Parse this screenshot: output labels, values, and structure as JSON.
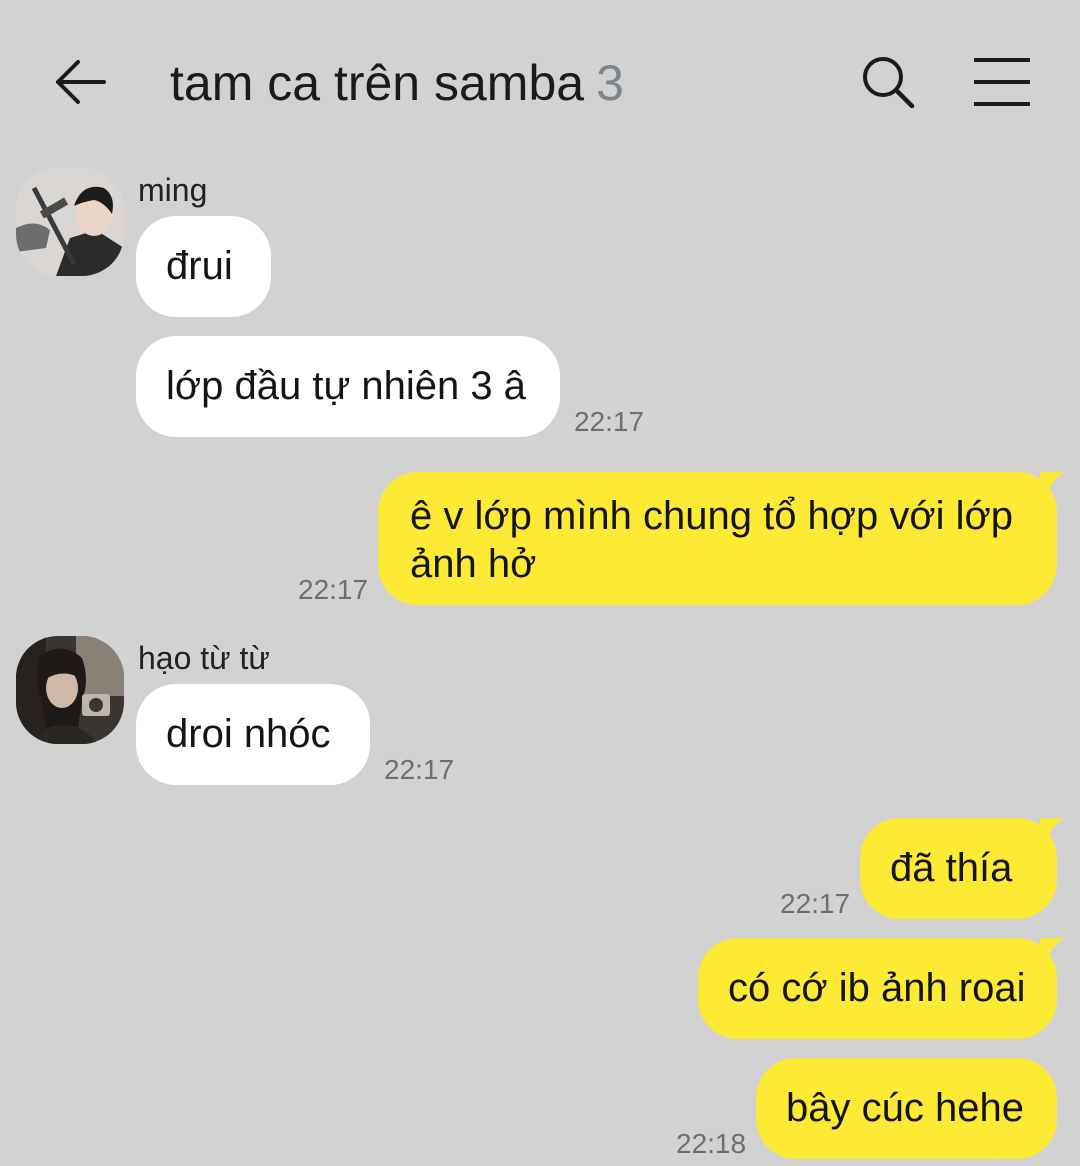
{
  "header": {
    "title": "tam ca trên samba",
    "member_count": "3",
    "back_icon": "back-arrow-icon",
    "search_icon": "search-icon",
    "menu_icon": "hamburger-menu-icon"
  },
  "colors": {
    "background": "#d2d2d2",
    "incoming_bubble": "#ffffff",
    "outgoing_bubble": "#fdea34",
    "member_count": "#7c868f",
    "timestamp": "#6f6f6f"
  },
  "messages": [
    {
      "sender": "ming",
      "text": "đrui",
      "direction": "incoming"
    },
    {
      "sender": "ming",
      "text": "lớp đầu tự nhiên 3 â",
      "time": "22:17",
      "direction": "incoming"
    },
    {
      "text": "ê v lớp mình chung tổ hợp với lớp ảnh hở",
      "time": "22:17",
      "direction": "outgoing"
    },
    {
      "sender": "hạo từ từ",
      "text": "droi nhóc",
      "time": "22:17",
      "direction": "incoming"
    },
    {
      "text": "đã thía",
      "time": "22:17",
      "direction": "outgoing"
    },
    {
      "text": "có cớ ib ảnh roai",
      "direction": "outgoing"
    },
    {
      "text": "bây cúc hehe",
      "time": "22:18",
      "direction": "outgoing"
    }
  ]
}
